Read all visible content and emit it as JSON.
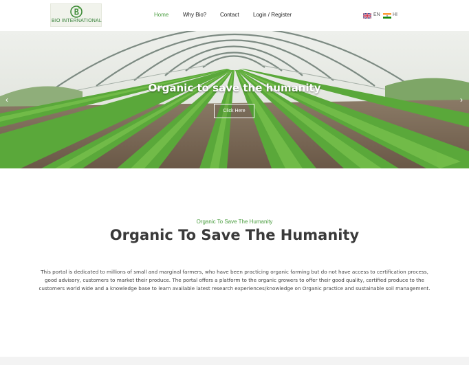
{
  "header": {
    "logo": {
      "text": "BIO INTERNATIONAL",
      "icon": "b-leaf-logo-icon"
    },
    "nav": [
      {
        "label": "Home",
        "active": true
      },
      {
        "label": "Why Bio?"
      },
      {
        "label": "Contact"
      },
      {
        "label": "Login / Register"
      }
    ],
    "languages": [
      {
        "code": "EN",
        "icon": "uk-flag-icon"
      },
      {
        "code": "HI",
        "icon": "india-flag-icon"
      }
    ]
  },
  "hero": {
    "title": "Organic to save the humanity",
    "button_label": "Click Here",
    "prev_icon": "chevron-left-icon",
    "next_icon": "chevron-right-icon"
  },
  "intro": {
    "subtitle": "Organic To Save The Humanity",
    "title": "Organic To Save The Humanity",
    "paragraph": "This portal is dedicated to millions of small and marginal farmers, who have been practicing organic farming but do not have access to certification process, good advisory, customers to market their produce. The portal offers a platform to the organic growers to offer their good quality, certified produce to the customers world wide and a knowledge base to learn available latest research experiences/knowledge on Organic practice and sustainable soil management."
  },
  "colors": {
    "accent": "#4a9d3f",
    "heading": "#3a3a3a"
  }
}
